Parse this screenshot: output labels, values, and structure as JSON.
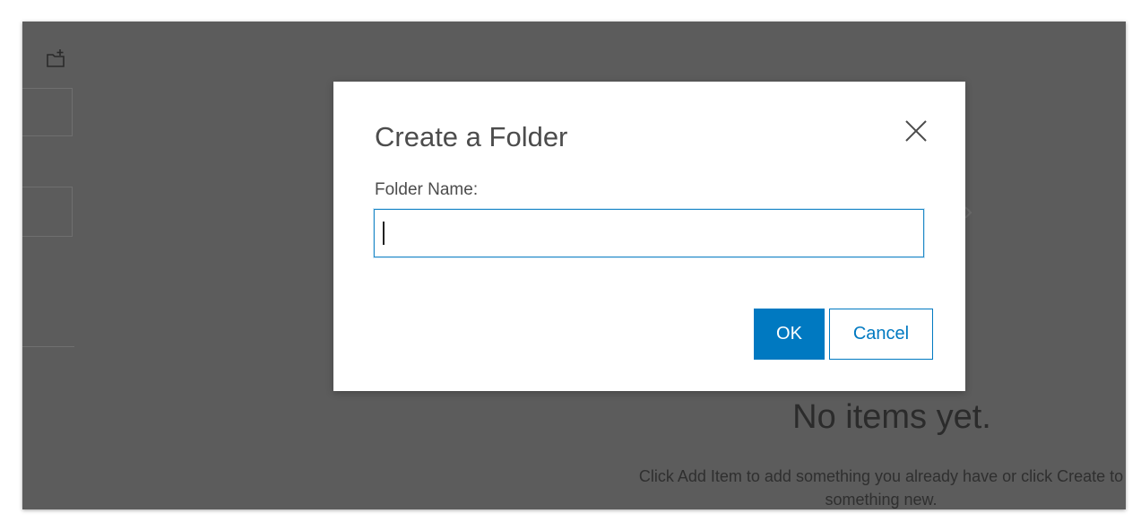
{
  "background": {
    "empty_state_title": "No items yet.",
    "empty_state_line1": "Click Add Item to add something you already have or click Create to",
    "empty_state_line2": "something new."
  },
  "dialog": {
    "title": "Create a Folder",
    "field_label": "Folder Name:",
    "folder_name_value": "",
    "ok_label": "OK",
    "cancel_label": "Cancel",
    "close_icon": "close-icon"
  },
  "icons": {
    "new_folder": "new-folder-icon",
    "chevron": "chevron-right-icon"
  },
  "colors": {
    "primary": "#0079c1",
    "overlay": "#5c5c5c",
    "text": "#4c4c4c"
  }
}
